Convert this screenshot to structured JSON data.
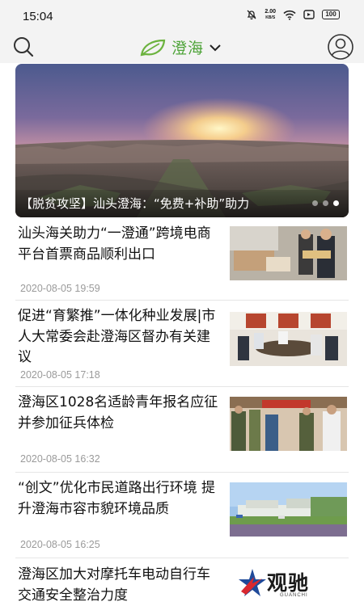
{
  "status_bar": {
    "time": "15:04",
    "net_speed_value": "2.00",
    "net_speed_unit": "KB/S",
    "battery": "100",
    "icons": [
      "mute-bell-icon",
      "wifi-icon",
      "sim-icon",
      "battery-icon"
    ]
  },
  "header": {
    "region": "澄海",
    "icons": [
      "search-icon",
      "leaf-logo-icon",
      "chevron-down-icon",
      "user-profile-icon"
    ],
    "accent_color": "#4fa43a"
  },
  "banner": {
    "title": "【脱贫攻坚】汕头澄海：“免费+补助”助力",
    "slide_count": 3,
    "active_slide": 3
  },
  "news": [
    {
      "title": "汕头海关助力“一澄通”跨境电商平台首票商品顺利出口",
      "date": "2020-08-05 19:59"
    },
    {
      "title": "促进“育繁推”一体化种业发展|市人大常委会赴澄海区督办有关建议",
      "date": "2020-08-05 17:18"
    },
    {
      "title": "澄海区1028名适龄青年报名应征并参加征兵体检",
      "date": "2020-08-05 16:32"
    },
    {
      "title": "“创文”优化市民道路出行环境 提升澄海市容市貌环境品质",
      "date": "2020-08-05 16:25"
    },
    {
      "title": "澄海区加大对摩托车电动自行车交通安全整治力度",
      "date": ""
    }
  ],
  "watermark": {
    "text": "观驰",
    "subtext": "GUANCHI"
  }
}
